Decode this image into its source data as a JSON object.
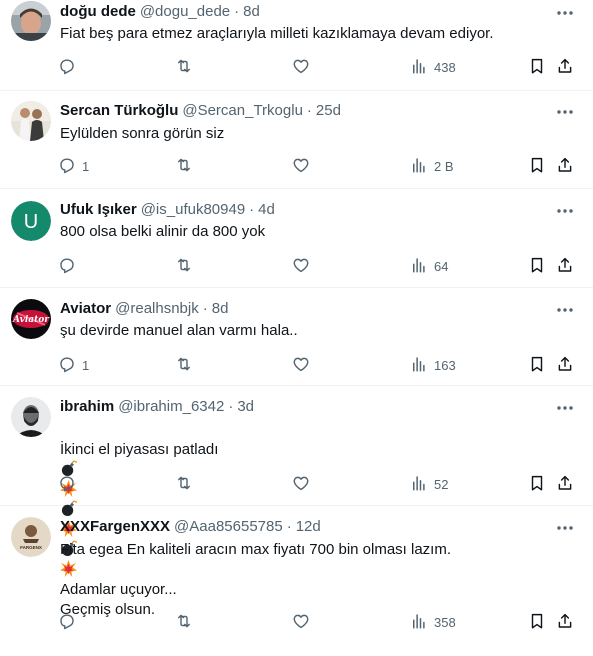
{
  "tweets": [
    {
      "name": "doğu dede",
      "handle": "@dogu_dede",
      "time": "8d",
      "text": "Fiat beş para etmez araçlarıyla milleti kazıklamaya devam ediyor.",
      "replies": "",
      "views": "438",
      "avatar": "photo-face"
    },
    {
      "name": "Sercan Türkoğlu",
      "handle": "@Sercan_Trkoglu",
      "time": "25d",
      "text": "Eylülden sonra görün siz",
      "replies": "1",
      "views": "2 B",
      "avatar": "photo-couple"
    },
    {
      "name": "Ufuk Işıker",
      "handle": "@is_ufuk80949",
      "time": "4d",
      "text": "800 olsa belki alinir da 800 yok",
      "replies": "",
      "views": "64",
      "avatar": "letter",
      "avatar_letter": "U",
      "avatar_color": "#15896b"
    },
    {
      "name": "Aviator",
      "handle": "@realhsnbjk",
      "time": "8d",
      "text": "şu devirde manuel alan varmı hala..",
      "replies": "1",
      "views": "163",
      "avatar": "logo-aviator",
      "avatar_logo_text": "Aviator"
    },
    {
      "name": "ibrahim",
      "handle": "@ibrahim_6342",
      "time": "3d",
      "text_line1": "İkinci el piyasası patladı",
      "text_line2": "Geçmiş olsun.",
      "emojis": [
        "bomb",
        "collision",
        "bomb",
        "collision",
        "bomb",
        "collision"
      ],
      "replies": "",
      "views": "52",
      "avatar": "photo-man"
    },
    {
      "name": "XXXFargenXXX",
      "handle": "@Aaa85655785",
      "time": "12d",
      "text": "Fita egea En kaliteli aracın max fiyatı 700 bin olması lazım.\n\nAdamlar uçuyor...",
      "replies": "",
      "views": "358",
      "avatar": "logo-badge",
      "avatar_logo_text": "FARGENX"
    }
  ],
  "separator": "·",
  "colors": {
    "text": "#0f1419",
    "secondary": "#536471",
    "divider": "#eff3f4"
  }
}
